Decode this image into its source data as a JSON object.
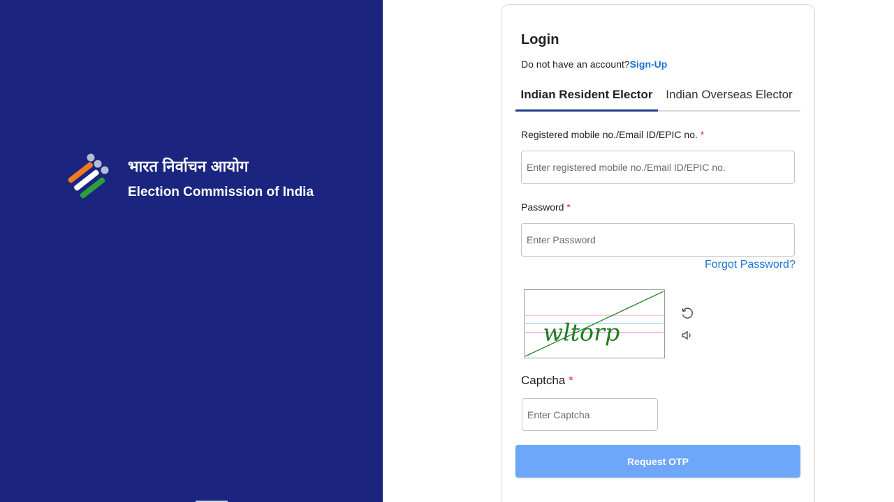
{
  "brand": {
    "hindi_name": "भारत निर्वाचन आयोग",
    "english_name": "Election Commission of India",
    "logo_icon": "eci-ballot-logo"
  },
  "login": {
    "title": "Login",
    "no_account_text": "Do not have an account?",
    "signup_label": "Sign-Up"
  },
  "tabs": [
    {
      "label": "Indian Resident Elector",
      "active": true
    },
    {
      "label": "Indian Overseas Elector",
      "active": false
    }
  ],
  "form": {
    "id_label": "Registered mobile no./Email ID/EPIC no.",
    "id_placeholder": "Enter registered mobile no./Email ID/EPIC no.",
    "password_label": "Password",
    "password_placeholder": "Enter Password",
    "forgot_password_label": "Forgot Password?",
    "captcha_label": "Captcha",
    "captcha_placeholder": "Enter Captcha",
    "required_mark": "*",
    "captcha_text": "wltorp",
    "submit_label": "Request OTP"
  },
  "colors": {
    "left_panel": "#1b2580",
    "accent_link": "#1976d2",
    "button": "#6ea6f9",
    "tab_indicator": "#1a3e8c",
    "captcha_text": "#1e7d1e"
  }
}
